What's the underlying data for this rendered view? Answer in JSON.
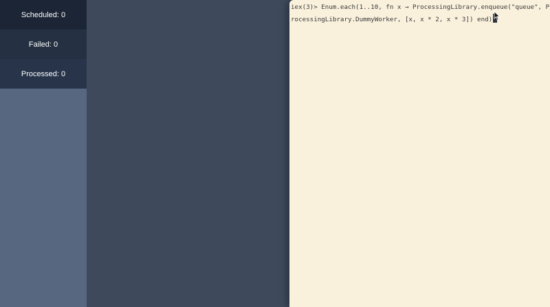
{
  "sidebar": {
    "stats": [
      {
        "label": "Scheduled: 0"
      },
      {
        "label": "Failed: 0"
      },
      {
        "label": "Processed: 0"
      }
    ]
  },
  "terminal": {
    "lines": [
      "iex(3)> Enum.each(1..10, fn x → ProcessingLibrary.enqueue(\"queue\", P",
      "rocessingLibrary.DummyWorker, [x, x * 2, x * 3]) end)"
    ]
  },
  "colors": {
    "sidebar_bg": "#56677f",
    "main_bg": "#3e4a5c",
    "terminal_bg": "#faf1dd",
    "stat_bg_dark": "#1c2535"
  },
  "icons": {
    "pointer": "mouse-pointer-icon"
  }
}
